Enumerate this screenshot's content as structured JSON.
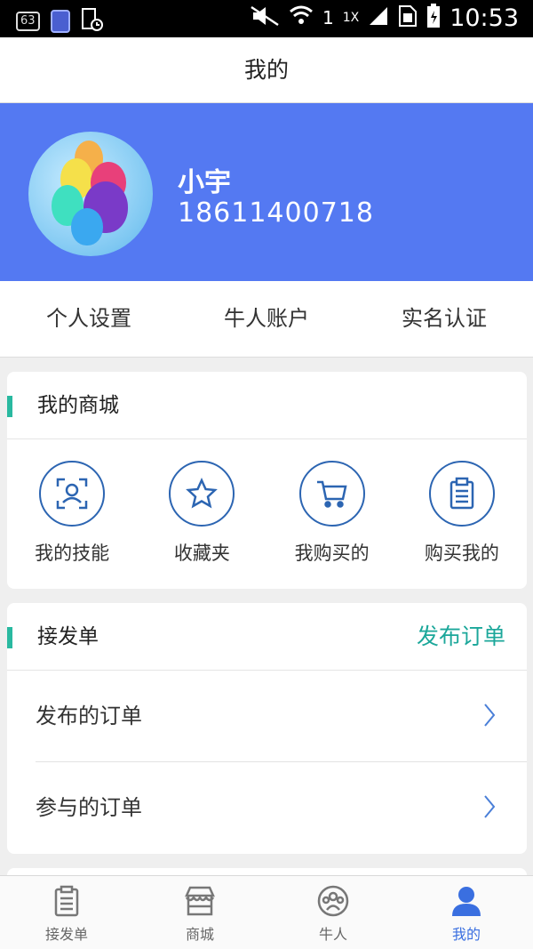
{
  "status_bar": {
    "badge": "63",
    "sim": "1",
    "network": "1X",
    "time": "10:53"
  },
  "header": {
    "title": "我的"
  },
  "profile": {
    "name": "小宇",
    "phone": "18611400718"
  },
  "quick_links": [
    {
      "label": "个人设置"
    },
    {
      "label": "牛人账户"
    },
    {
      "label": "实名认证"
    }
  ],
  "shop": {
    "title": "我的商城",
    "items": [
      {
        "label": "我的技能",
        "icon": "skill-icon"
      },
      {
        "label": "收藏夹",
        "icon": "star-icon"
      },
      {
        "label": "我购买的",
        "icon": "cart-icon"
      },
      {
        "label": "购买我的",
        "icon": "clipboard-icon"
      }
    ]
  },
  "orders": {
    "title": "接发单",
    "action": "发布订单",
    "rows": [
      {
        "label": "发布的订单"
      },
      {
        "label": "参与的订单"
      }
    ]
  },
  "bottom_nav": [
    {
      "label": "接发单",
      "icon": "clipboard-icon",
      "active": false
    },
    {
      "label": "商城",
      "icon": "store-icon",
      "active": false
    },
    {
      "label": "牛人",
      "icon": "group-icon",
      "active": false
    },
    {
      "label": "我的",
      "icon": "person-icon",
      "active": true
    }
  ],
  "colors": {
    "profile_bg": "#5479f2",
    "accent_teal": "#1ba79a",
    "icon_blue": "#2c65b2",
    "active_nav": "#3a6fe0"
  }
}
